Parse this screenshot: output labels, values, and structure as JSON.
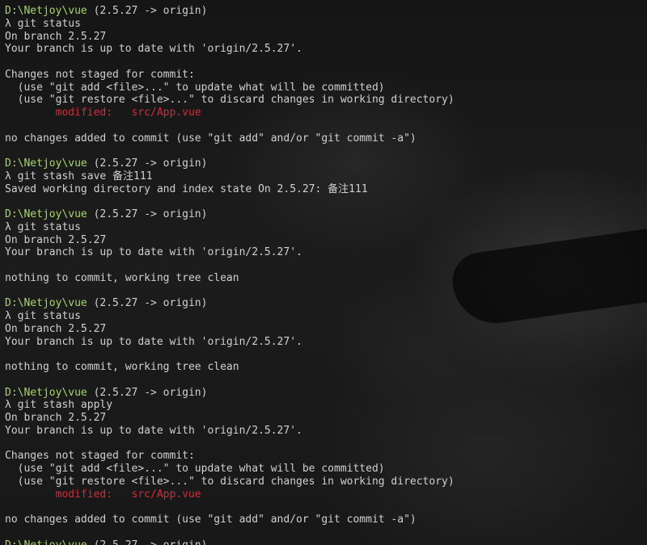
{
  "colors": {
    "background": "#161616",
    "text": "#d0d0d0",
    "prompt_path": "#a8d46a",
    "modified": "#d02c3c"
  },
  "terminal": {
    "lines": [
      [
        {
          "text": "D:\\Netjoy\\vue",
          "color": "green"
        },
        {
          "text": " (2.5.27 -> origin)",
          "color": "white"
        }
      ],
      [
        {
          "text": "λ git status",
          "color": "white"
        }
      ],
      [
        {
          "text": "On branch 2.5.27",
          "color": "white"
        }
      ],
      [
        {
          "text": "Your branch is up to date with 'origin/2.5.27'.",
          "color": "white"
        }
      ],
      [],
      [
        {
          "text": "Changes not staged for commit:",
          "color": "white"
        }
      ],
      [
        {
          "text": "  (use \"git add <file>...\" to update what will be committed)",
          "color": "white"
        }
      ],
      [
        {
          "text": "  (use \"git restore <file>...\" to discard changes in working directory)",
          "color": "white"
        }
      ],
      [
        {
          "text": "        modified:   src/App.vue",
          "color": "red"
        }
      ],
      [],
      [
        {
          "text": "no changes added to commit (use \"git add\" and/or \"git commit -a\")",
          "color": "white"
        }
      ],
      [],
      [
        {
          "text": "D:\\Netjoy\\vue",
          "color": "green"
        },
        {
          "text": " (2.5.27 -> origin)",
          "color": "white"
        }
      ],
      [
        {
          "text": "λ git stash save 备注111",
          "color": "white"
        }
      ],
      [
        {
          "text": "Saved working directory and index state On 2.5.27: 备注111",
          "color": "white"
        }
      ],
      [],
      [
        {
          "text": "D:\\Netjoy\\vue",
          "color": "green"
        },
        {
          "text": " (2.5.27 -> origin)",
          "color": "white"
        }
      ],
      [
        {
          "text": "λ git status",
          "color": "white"
        }
      ],
      [
        {
          "text": "On branch 2.5.27",
          "color": "white"
        }
      ],
      [
        {
          "text": "Your branch is up to date with 'origin/2.5.27'.",
          "color": "white"
        }
      ],
      [],
      [
        {
          "text": "nothing to commit, working tree clean",
          "color": "white"
        }
      ],
      [],
      [
        {
          "text": "D:\\Netjoy\\vue",
          "color": "green"
        },
        {
          "text": " (2.5.27 -> origin)",
          "color": "white"
        }
      ],
      [
        {
          "text": "λ git status",
          "color": "white"
        }
      ],
      [
        {
          "text": "On branch 2.5.27",
          "color": "white"
        }
      ],
      [
        {
          "text": "Your branch is up to date with 'origin/2.5.27'.",
          "color": "white"
        }
      ],
      [],
      [
        {
          "text": "nothing to commit, working tree clean",
          "color": "white"
        }
      ],
      [],
      [
        {
          "text": "D:\\Netjoy\\vue",
          "color": "green"
        },
        {
          "text": " (2.5.27 -> origin)",
          "color": "white"
        }
      ],
      [
        {
          "text": "λ git stash apply",
          "color": "white"
        }
      ],
      [
        {
          "text": "On branch 2.5.27",
          "color": "white"
        }
      ],
      [
        {
          "text": "Your branch is up to date with 'origin/2.5.27'.",
          "color": "white"
        }
      ],
      [],
      [
        {
          "text": "Changes not staged for commit:",
          "color": "white"
        }
      ],
      [
        {
          "text": "  (use \"git add <file>...\" to update what will be committed)",
          "color": "white"
        }
      ],
      [
        {
          "text": "  (use \"git restore <file>...\" to discard changes in working directory)",
          "color": "white"
        }
      ],
      [
        {
          "text": "        modified:   src/App.vue",
          "color": "red"
        }
      ],
      [],
      [
        {
          "text": "no changes added to commit (use \"git add\" and/or \"git commit -a\")",
          "color": "white"
        }
      ],
      [],
      [
        {
          "text": "D:\\Netjoy\\vue",
          "color": "green"
        },
        {
          "text": " (2.5.27 -> origin)",
          "color": "white"
        }
      ]
    ]
  }
}
